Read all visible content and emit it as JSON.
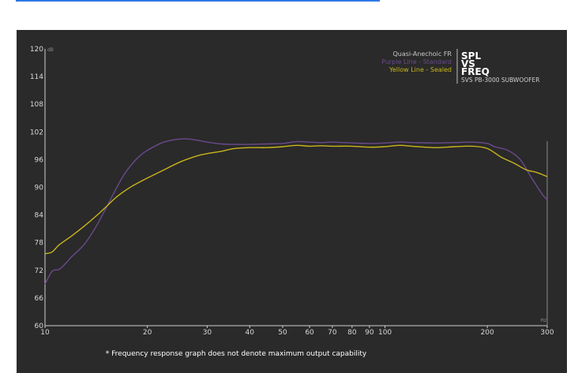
{
  "chart_data": {
    "type": "line",
    "title": "",
    "xlabel": "",
    "ylabel": "",
    "x_unit": "Hz",
    "y_unit": "dB",
    "x_scale": "log",
    "xlim": [
      10,
      300
    ],
    "ylim": [
      60,
      120
    ],
    "x_ticks": [
      10,
      20,
      30,
      40,
      50,
      60,
      70,
      80,
      90,
      100,
      200,
      300
    ],
    "y_ticks": [
      60,
      66,
      72,
      78,
      84,
      90,
      96,
      102,
      108,
      114,
      120
    ],
    "grid": false,
    "legend": {
      "position": "top-right",
      "heading": "Quasi-Anechoic FR",
      "entries": [
        "Purple Line - Standard",
        "Yellow Line - Sealed"
      ]
    },
    "brand": {
      "line1": "SPL",
      "line2": "VS",
      "line3": "FREQ",
      "product": "SVS PB-3000 SUBWOOFER"
    },
    "footnote": "* Frequency response graph does not denote maximum output capability",
    "series": [
      {
        "color": "#6a4a8c",
        "points": [
          [
            10,
            69
          ],
          [
            10.5,
            71.8
          ],
          [
            11,
            72.2
          ],
          [
            11.5,
            73.5
          ],
          [
            12,
            75
          ],
          [
            13,
            77.5
          ],
          [
            14,
            81
          ],
          [
            15,
            85
          ],
          [
            16,
            89
          ],
          [
            17,
            92.5
          ],
          [
            18,
            95
          ],
          [
            19,
            96.8
          ],
          [
            20,
            98
          ],
          [
            22,
            99.6
          ],
          [
            24,
            100.3
          ],
          [
            26,
            100.5
          ],
          [
            28,
            100.2
          ],
          [
            30,
            99.8
          ],
          [
            33,
            99.4
          ],
          [
            36,
            99.3
          ],
          [
            40,
            99.3
          ],
          [
            45,
            99.4
          ],
          [
            50,
            99.5
          ],
          [
            55,
            99.9
          ],
          [
            60,
            99.8
          ],
          [
            65,
            99.7
          ],
          [
            70,
            99.8
          ],
          [
            80,
            99.6
          ],
          [
            90,
            99.5
          ],
          [
            100,
            99.6
          ],
          [
            110,
            99.8
          ],
          [
            120,
            99.7
          ],
          [
            140,
            99.6
          ],
          [
            160,
            99.7
          ],
          [
            180,
            99.8
          ],
          [
            200,
            99.5
          ],
          [
            210,
            98.8
          ],
          [
            230,
            98
          ],
          [
            250,
            96
          ],
          [
            270,
            92
          ],
          [
            290,
            88.5
          ],
          [
            300,
            87.3
          ]
        ]
      },
      {
        "color": "#c9b51c",
        "points": [
          [
            10,
            75.6
          ],
          [
            10.5,
            76
          ],
          [
            11,
            77.5
          ],
          [
            12,
            79.5
          ],
          [
            13,
            81.5
          ],
          [
            14,
            83.5
          ],
          [
            15,
            85.5
          ],
          [
            16,
            87.5
          ],
          [
            17,
            89
          ],
          [
            18,
            90.2
          ],
          [
            20,
            92
          ],
          [
            22,
            93.5
          ],
          [
            25,
            95.5
          ],
          [
            28,
            96.8
          ],
          [
            30,
            97.3
          ],
          [
            33,
            97.8
          ],
          [
            36,
            98.4
          ],
          [
            40,
            98.6
          ],
          [
            45,
            98.6
          ],
          [
            50,
            98.8
          ],
          [
            55,
            99.1
          ],
          [
            60,
            98.9
          ],
          [
            65,
            99
          ],
          [
            70,
            98.9
          ],
          [
            80,
            98.9
          ],
          [
            90,
            98.7
          ],
          [
            100,
            98.8
          ],
          [
            110,
            99.1
          ],
          [
            120,
            98.9
          ],
          [
            140,
            98.6
          ],
          [
            160,
            98.8
          ],
          [
            180,
            98.9
          ],
          [
            200,
            98.4
          ],
          [
            220,
            96.5
          ],
          [
            240,
            95.2
          ],
          [
            260,
            93.8
          ],
          [
            280,
            93.2
          ],
          [
            300,
            92.3
          ]
        ]
      }
    ]
  }
}
